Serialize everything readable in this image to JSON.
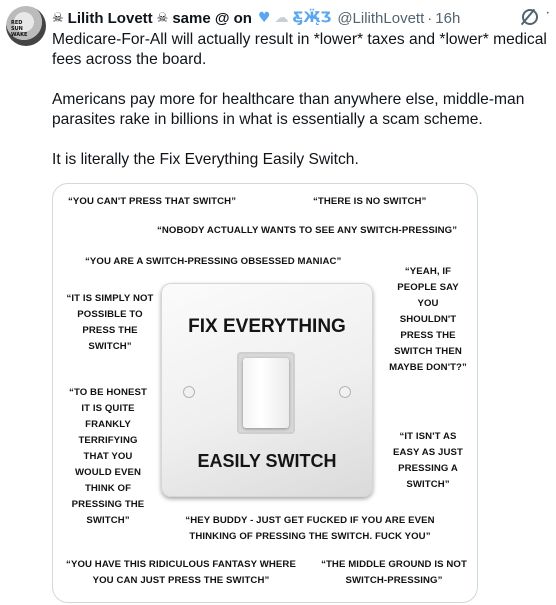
{
  "author": {
    "name": "Lilith Lovett",
    "badge_emoji": "☠",
    "status": "same @ on",
    "handle": "@LilithLovett",
    "separator": "·",
    "time": "16h",
    "avatar_text": "RED\nSUN\nWAKE"
  },
  "tweet": {
    "lines": [
      "Medicare-For-All will actually result in *lower* taxes and *lower* medical fees across the board.",
      "Americans pay more for healthcare than anywhere else, middle-man parasites rake in billions in what is essentially a scam scheme.",
      "It is literally the Fix Everything Easily Switch."
    ]
  },
  "meme": {
    "plate_top": "FIX EVERYTHING",
    "plate_bottom": "EASILY SWITCH",
    "quotes": {
      "q1": "“YOU CAN'T PRESS THAT SWITCH”",
      "q2": "“THERE IS NO SWITCH”",
      "q3": "“NOBODY ACTUALLY WANTS TO SEE ANY SWITCH-PRESSING”",
      "q4": "“YOU ARE A SWITCH-PRESSING OBSESSED MANIAC”",
      "q5": "“IT IS SIMPLY NOT POSSIBLE TO PRESS THE SWITCH”",
      "q6": "“YEAH, IF PEOPLE SAY YOU SHOULDN'T PRESS THE SWITCH THEN MAYBE DON'T?”",
      "q7": "“TO BE HONEST IT IS QUITE FRANKLY TERRIFYING THAT YOU WOULD EVEN THINK OF PRESSING THE SWITCH”",
      "q8": "“IT ISN'T AS EASY AS JUST PRESSING A SWITCH”",
      "q9": "“HEY BUDDY - JUST GET FUCKED IF YOU ARE EVEN THINKING OF PRESSING THE SWITCH. FUCK YOU”",
      "q10": "“YOU HAVE THIS RIDICULOUS FANTASY WHERE YOU CAN JUST PRESS THE SWITCH”",
      "q11": "“THE MIDDLE GROUND IS NOT SWITCH-PRESSING”"
    }
  },
  "colors": {
    "text": "#0f1419",
    "muted": "#536471",
    "accent": "#5aa7f0"
  },
  "icons": {
    "badge": "skull-crossbones-icon",
    "heart": "blue-heart-icon",
    "cloud": "cloud-icon",
    "butterfly": "butterfly-icon",
    "grok": "grok-icon",
    "more": "more-icon"
  }
}
